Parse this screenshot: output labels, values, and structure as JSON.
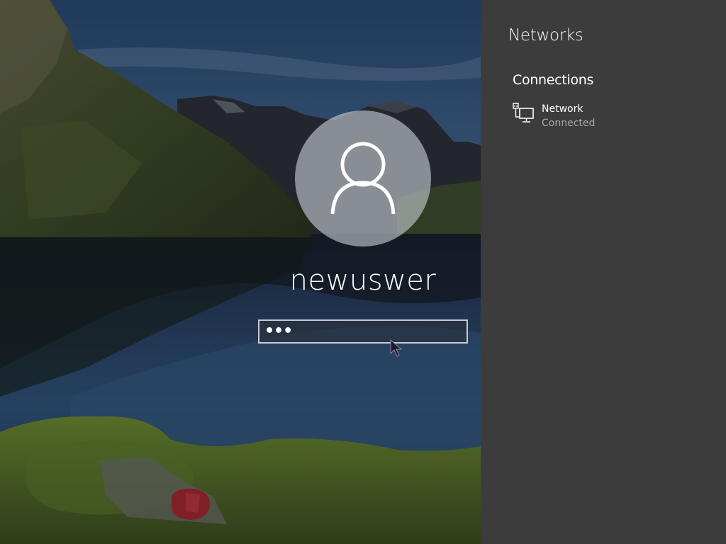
{
  "login": {
    "username": "newuswer",
    "password_value": "•••",
    "submit_icon": "arrow-right-icon",
    "avatar_icon": "user-icon"
  },
  "networks_panel": {
    "title": "Networks",
    "section_title": "Connections",
    "connections": [
      {
        "name": "Network",
        "status": "Connected",
        "icon": "wired-network-icon"
      }
    ]
  },
  "colors": {
    "panel_background": "#3c3c3c",
    "status_text": "#a8a8a8"
  }
}
